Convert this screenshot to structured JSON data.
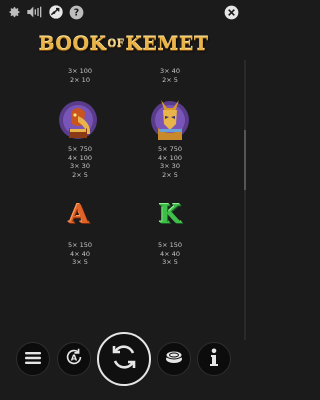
{
  "top_icons": [
    "gear-icon",
    "sound-icon",
    "turbo-icon",
    "help-icon",
    "close-icon"
  ],
  "logo": {
    "part1": "BOOK",
    "part2": "OF",
    "part3": "KEMET"
  },
  "rows": [
    {
      "left": {
        "symbol": "",
        "pays": [
          "3× 100",
          "2× 10"
        ]
      },
      "right": {
        "symbol": "",
        "pays": [
          "3× 40",
          "2× 5"
        ]
      }
    },
    {
      "left": {
        "symbol": "ibis-god-icon",
        "pays": [
          "5× 750",
          "4× 100",
          "3× 30",
          "2× 5"
        ]
      },
      "right": {
        "symbol": "jackal-god-icon",
        "pays": [
          "5× 750",
          "4× 100",
          "3× 30",
          "2× 5"
        ]
      }
    },
    {
      "left": {
        "symbol": "letter-a-icon",
        "glyph": "A",
        "color": "#e0632a",
        "pays": [
          "5× 150",
          "4× 40",
          "3× 5"
        ]
      },
      "right": {
        "symbol": "letter-k-icon",
        "glyph": "K",
        "color": "#3fbf4a",
        "pays": [
          "5× 150",
          "4× 40",
          "3× 5"
        ]
      }
    }
  ],
  "bottom_buttons": [
    "menu-icon",
    "autoplay-icon",
    "spin-icon",
    "coin-stake-icon",
    "info-icon"
  ],
  "colors": {
    "background": "#1b1b1b",
    "gold": "#e9b44a",
    "text": "#c9c9c9"
  }
}
